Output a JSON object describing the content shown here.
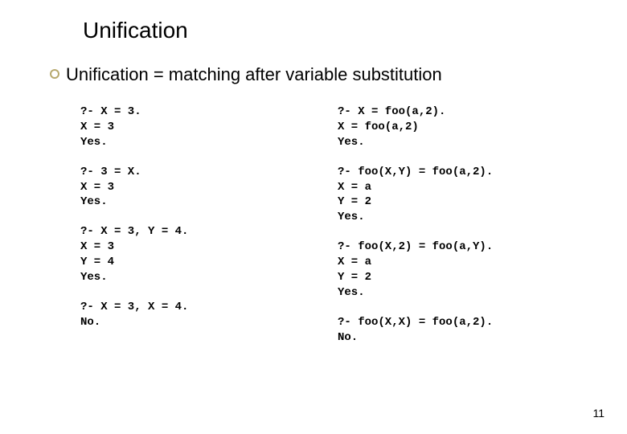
{
  "title": "Unification",
  "subtitle": "Unification = matching after variable substitution",
  "left": [
    "?- X = 3.\nX = 3\nYes.",
    "?- 3 = X.\nX = 3\nYes.",
    "?- X = 3, Y = 4.\nX = 3\nY = 4\nYes.",
    "?- X = 3, X = 4.\nNo."
  ],
  "right": [
    "?- X = foo(a,2).\nX = foo(a,2)\nYes.",
    "?- foo(X,Y) = foo(a,2).\nX = a\nY = 2\nYes.",
    "?- foo(X,2) = foo(a,Y).\nX = a\nY = 2\nYes.",
    "?- foo(X,X) = foo(a,2).\nNo."
  ],
  "page_number": "11"
}
